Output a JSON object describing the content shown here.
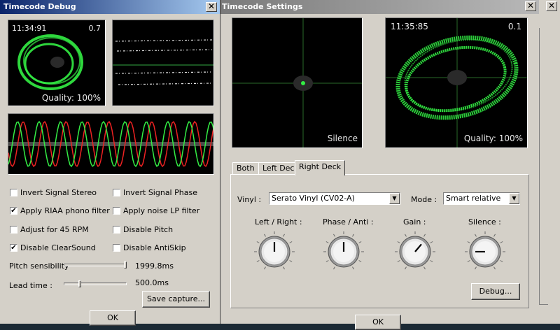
{
  "debug": {
    "title": "Timecode Debug",
    "scope": {
      "time": "11:34:91",
      "speed": "0.7",
      "quality": "Quality: 100%"
    },
    "options": [
      {
        "label": "Invert Signal Stereo",
        "checked": false
      },
      {
        "label": "Invert Signal Phase",
        "checked": false
      },
      {
        "label": "Apply RIAA phono filter",
        "checked": true
      },
      {
        "label": "Apply noise LP filter",
        "checked": false
      },
      {
        "label": "Adjust for 45 RPM",
        "checked": false
      },
      {
        "label": "Disable Pitch",
        "checked": false
      },
      {
        "label": "Disable ClearSound",
        "checked": true
      },
      {
        "label": "Disable AntiSkip",
        "checked": false
      }
    ],
    "pitch_label": "Pitch sensibility",
    "pitch_value": "1999.8ms",
    "lead_label": "Lead time :",
    "lead_value": "500.0ms",
    "save_label": "Save capture...",
    "ok_label": "OK",
    "check_mark": "✔"
  },
  "settings": {
    "title": "Timecode Settings",
    "left_scope": {
      "status": "Silence"
    },
    "right_scope": {
      "time": "11:35:85",
      "speed": "0.1",
      "quality": "Quality: 100%"
    },
    "tabs": [
      "Both",
      "Left Deck",
      "Right Deck"
    ],
    "vinyl_label": "Vinyl :",
    "vinyl_value": "Serato Vinyl (CV02-A)",
    "mode_label": "Mode :",
    "mode_value": "Smart relative",
    "knobs": [
      {
        "label": "Left / Right :",
        "angle": 0
      },
      {
        "label": "Phase / Anti :",
        "angle": 0
      },
      {
        "label": "Gain :",
        "angle": 40
      },
      {
        "label": "Silence :",
        "angle": -90
      }
    ],
    "debug_label": "Debug...",
    "ok_label": "OK"
  },
  "close_glyph": "✕",
  "colors": {
    "scope_green": "#33ee44",
    "wave_red": "#ee2222",
    "title_blue": "#0a246a"
  }
}
